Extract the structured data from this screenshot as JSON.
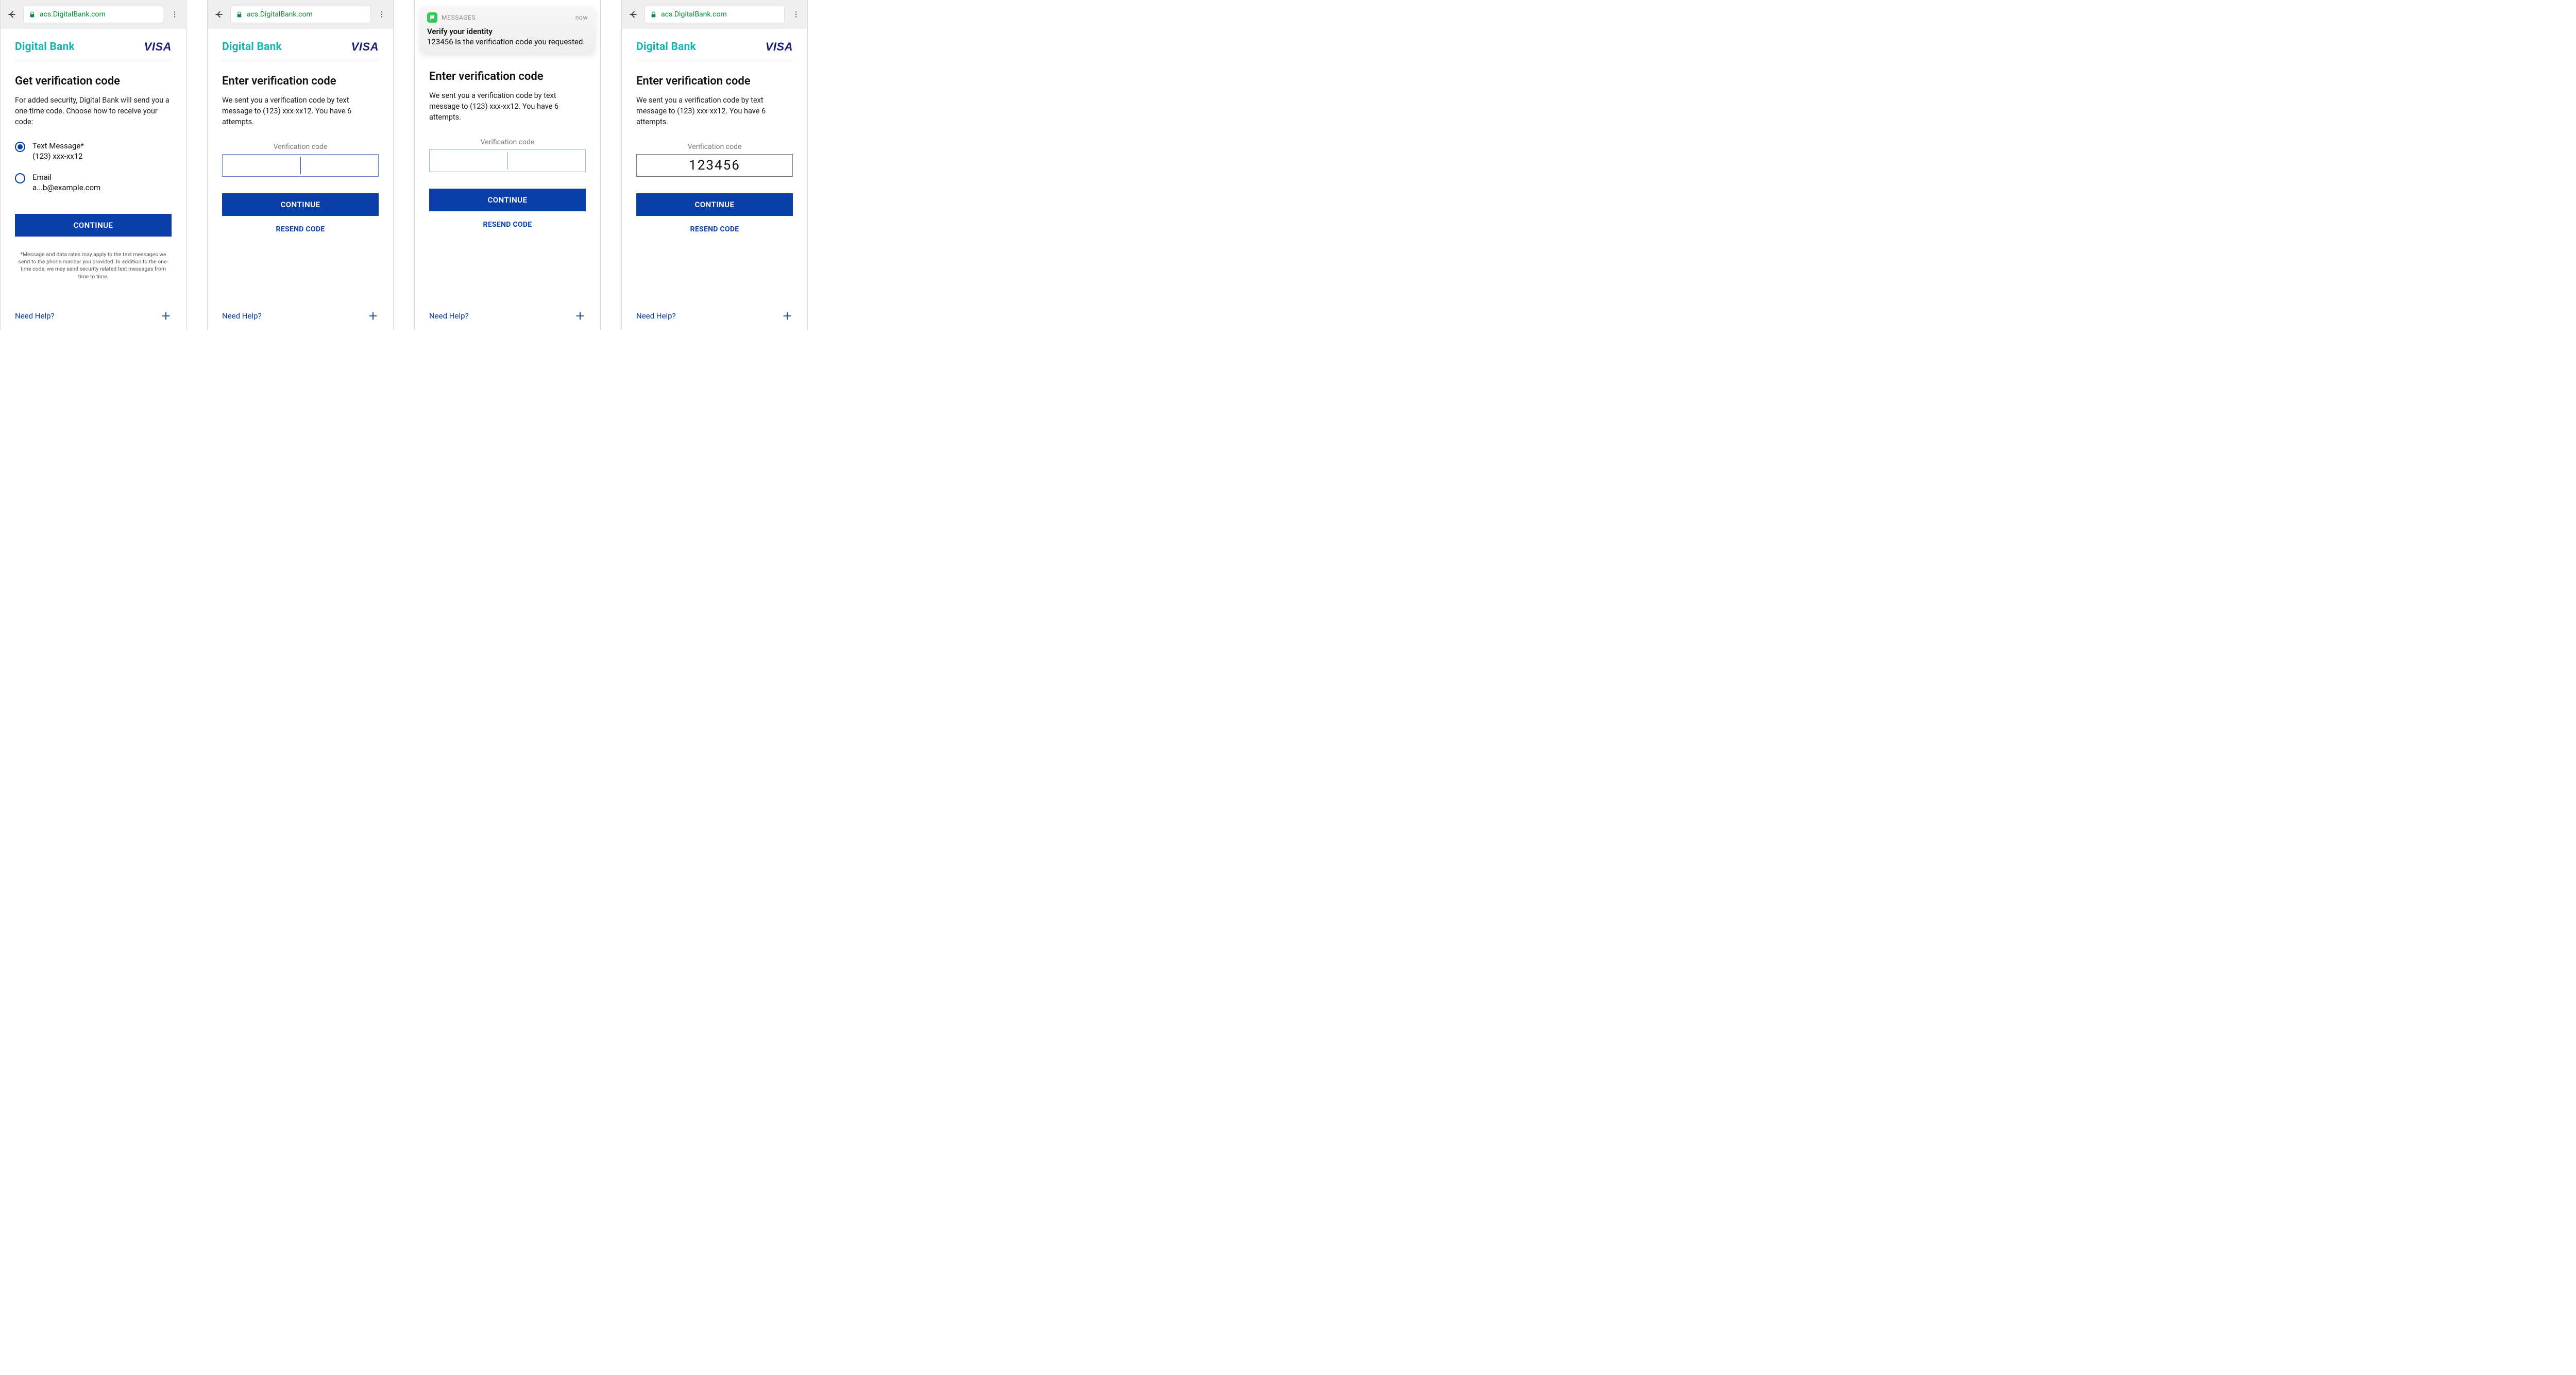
{
  "common": {
    "url": "acs.DigitalBank.com",
    "merchant": "Digital Bank",
    "network": "VISA",
    "help_label": "Need Help?",
    "continue_label": "CONTINUE",
    "resend_label": "RESEND CODE"
  },
  "screen1": {
    "heading": "Get verification code",
    "body": "For added security, Digital Bank will send you a one-time code. Choose how to receive your code:",
    "opt_text_label": "Text Message*",
    "opt_text_value": "(123) xxx-xx12",
    "opt_email_label": "Email",
    "opt_email_value": "a...b@example.com",
    "disclaimer": "*Message and data rates may apply to the text messages we send to the phone number you provided. In addition to the one-time code, we may send security related text messages from time to time."
  },
  "screen2": {
    "heading": "Enter verification code",
    "body": "We sent you a verification code by text message to (123) xxx-xx12. You have 6 attempts.",
    "field_label": "Verification code",
    "code_value": ""
  },
  "screen3": {
    "heading": "Enter verification code",
    "body": "We sent you a verification code by text message to (123) xxx-xx12. You have 6 attempts.",
    "field_label": "Verification code",
    "code_value": "",
    "notif_app": "MESSAGES",
    "notif_time": "now",
    "notif_title": "Verify your identity",
    "notif_body": "123456 is the verification code you requested."
  },
  "screen4": {
    "heading": "Enter verification code",
    "body": "We sent you a verification code by text message to (123) xxx-xx12. You have 6 attempts.",
    "field_label": "Verification code",
    "code_value": "123456"
  }
}
